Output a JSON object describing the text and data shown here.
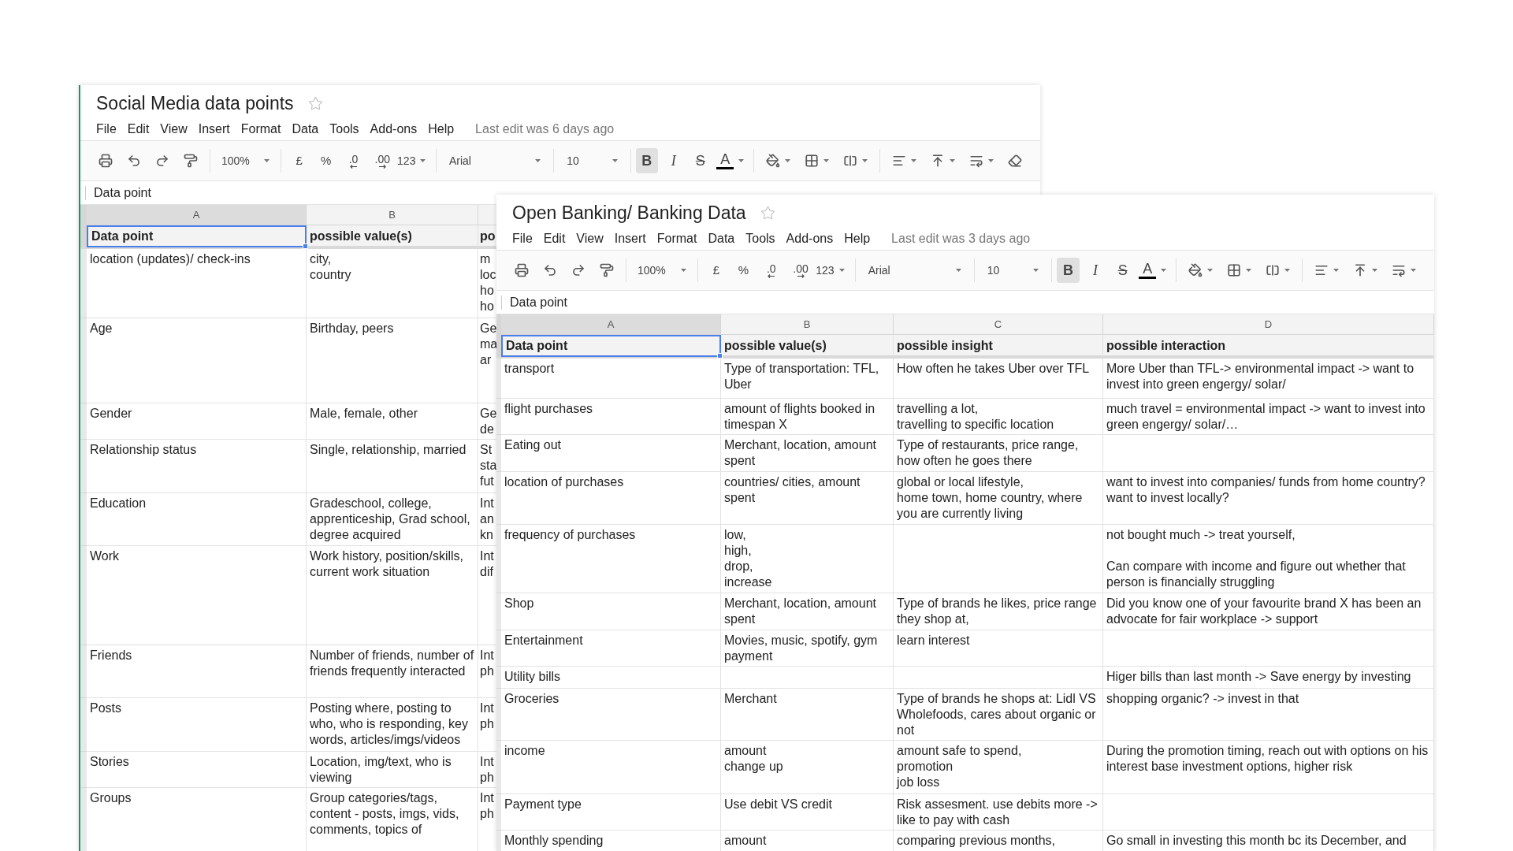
{
  "windows": [
    {
      "title": "Social Media data points",
      "starred": false,
      "menu": [
        "File",
        "Edit",
        "View",
        "Insert",
        "Format",
        "Data",
        "Tools",
        "Add-ons",
        "Help"
      ],
      "last_edit": "Last edit was 6 days ago",
      "toolbar": {
        "zoom": "100%",
        "currency": "£",
        "percent": "%",
        "decrease_decimals": ".0",
        "increase_decimals": ".00",
        "more_formats": "123",
        "font": "Arial",
        "font_size": "10",
        "bold": {
          "label": "B",
          "on": true
        },
        "italic": {
          "label": "I",
          "on": false
        },
        "strike": {
          "label": "S",
          "on": false
        },
        "text_color": "A"
      },
      "formula": "Data point",
      "columns": [
        {
          "label": "A",
          "selected": true
        },
        {
          "label": "B",
          "selected": false
        }
      ],
      "header": [
        {
          "text": "Data point",
          "selected": true
        },
        {
          "text": "possible value(s)",
          "selected": false
        },
        {
          "text": "po",
          "selected": false
        }
      ],
      "rows": [
        [
          "location (updates)/ check-ins",
          "city,\ncountry",
          "m\nloc\nho\nho"
        ],
        [
          "Age",
          "Birthday, peers",
          "Ge\nma\nar"
        ],
        [
          "Gender",
          "Male, female, other",
          "Ge\nde"
        ],
        [
          "Relationship status",
          "Single, relationship, married",
          "St\nsta\nfut"
        ],
        [
          "Education",
          "Gradeschool, college, apprenticeship, Grad school, degree acquired",
          "Int\nan\nkn"
        ],
        [
          "Work",
          "Work history, position/skills, current work situation",
          "Int\ndif"
        ],
        [
          "Friends",
          "Number of friends, number of friends frequently interacted",
          "Int\nph"
        ],
        [
          "Posts",
          "Posting where, posting to who, who is responding, key words, articles/imgs/videos",
          "Int\nph"
        ],
        [
          "Stories",
          "Location, img/text, who is viewing",
          "Int\nph"
        ],
        [
          "Groups",
          "Group categories/tags, content - posts, imgs, vids, comments, topics of",
          "Int\nph"
        ]
      ]
    },
    {
      "title": "Open Banking/ Banking Data",
      "starred": false,
      "menu": [
        "File",
        "Edit",
        "View",
        "Insert",
        "Format",
        "Data",
        "Tools",
        "Add-ons",
        "Help"
      ],
      "last_edit": "Last edit was 3 days ago",
      "toolbar": {
        "zoom": "100%",
        "currency": "£",
        "percent": "%",
        "decrease_decimals": ".0",
        "increase_decimals": ".00",
        "more_formats": "123",
        "font": "Arial",
        "font_size": "10",
        "bold": {
          "label": "B",
          "on": true
        },
        "italic": {
          "label": "I",
          "on": false
        },
        "strike": {
          "label": "S",
          "on": false
        },
        "text_color": "A"
      },
      "formula": "Data point",
      "columns": [
        {
          "label": "A",
          "selected": true
        },
        {
          "label": "B",
          "selected": false
        },
        {
          "label": "C",
          "selected": false
        },
        {
          "label": "D",
          "selected": false
        }
      ],
      "header": [
        {
          "text": "Data point",
          "selected": true
        },
        {
          "text": "possible value(s)",
          "selected": false
        },
        {
          "text": "possible insight",
          "selected": false
        },
        {
          "text": "possible interaction",
          "selected": false
        }
      ],
      "rows": [
        [
          "transport",
          "Type of transportation: TFL, Uber",
          "How often he takes Uber over TFL",
          "More Uber than TFL-> environmental impact -> want to invest into green engergy/ solar/"
        ],
        [
          "flight purchases",
          "amount of flights booked in timespan X",
          "travelling a lot,\ntravelling to specific location",
          "much travel = environmental impact -> want to invest into green engergy/ solar/…"
        ],
        [
          "Eating out",
          "Merchant, location, amount spent",
          "Type of restaurants, price range,\nhow often he goes there",
          null
        ],
        [
          "location of purchases",
          "countries/ cities, amount spent",
          "global or local lifestyle,\nhome town, home country, where you are currently living",
          "want to invest into companies/ funds from home country?\nwant to invest locally?"
        ],
        [
          "frequency of purchases",
          "low,\nhigh,\ndrop,\nincrease",
          null,
          "not bought much -> treat yourself,\n\nCan compare with income and figure out whether that person is financially struggling"
        ],
        [
          "Shop",
          "Merchant, location, amount spent",
          "Type of brands he likes, price range they shop at,",
          "Did you know one of your favourite brand X has been an advocate for fair workplace -> support"
        ],
        [
          "Entertainment",
          "Movies, music, spotify, gym payment",
          "learn interest",
          null
        ],
        [
          "Utility bills",
          null,
          null,
          "Higer bills than last month -> Save energy by investing"
        ],
        [
          "Groceries",
          "Merchant",
          "Type of brands he shops at: Lidl VS Wholefoods, cares about organic or not",
          "shopping organic? -> invest in that"
        ],
        [
          "income",
          "amount\nchange up",
          "amount safe to spend,\npromotion\njob loss",
          "During the promotion timing, reach out with options on his interest base investment options, higher risk"
        ],
        [
          "Payment type",
          "Use debit VS credit",
          "Risk assesment. use debits more -> like to pay with cash",
          null
        ],
        [
          "Monthly spending",
          "amount",
          "comparing previous months,",
          "Go small in investing this month bc its December, and"
        ]
      ]
    }
  ]
}
